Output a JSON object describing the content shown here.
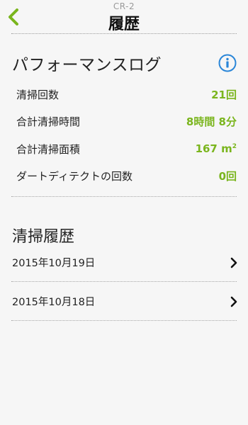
{
  "header": {
    "device_name": "CR-2",
    "title": "履歴",
    "back_icon": "chevron-left-icon",
    "accent_color": "#7ab51d"
  },
  "performance_log": {
    "title": "パフォーマンスログ",
    "info_icon": "info-icon",
    "stats": [
      {
        "label": "清掃回数",
        "value": "21回"
      },
      {
        "label": "合計清掃時間",
        "value": "8時間 8分"
      },
      {
        "label": "合計清掃面積",
        "value": "167 m",
        "unit_sup": "2"
      },
      {
        "label": "ダートディテクトの回数",
        "value": "0回"
      }
    ]
  },
  "cleaning_history": {
    "title": "清掃履歴",
    "items": [
      {
        "date": "2015年10月19日"
      },
      {
        "date": "2015年10月18日"
      }
    ]
  }
}
